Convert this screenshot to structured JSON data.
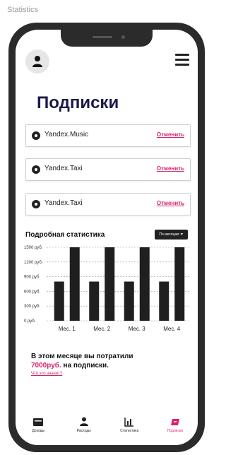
{
  "frame_caption": "Statistics",
  "header": {
    "title": "Подписки"
  },
  "subscriptions": [
    {
      "name": "Yandex.Music",
      "action": "Отменить"
    },
    {
      "name": "Yandex.Taxi",
      "action": "Отменить"
    },
    {
      "name": "Yandex.Taxi",
      "action": "Отменить"
    }
  ],
  "stats": {
    "title": "Подробная статистика",
    "period_select": "По месяцам ▼"
  },
  "chart_data": {
    "type": "bar",
    "categories": [
      "Mес. 1",
      "Mес. 2",
      "Mес. 3",
      "Mес. 4"
    ],
    "y_tick_labels": [
      "1500 руб.",
      "1200 руб.",
      "900 руб.",
      "600 руб.",
      "300 руб.",
      "0 руб."
    ],
    "ylim": [
      0,
      1500
    ],
    "series": [
      {
        "values": [
          800,
          800,
          800,
          800
        ]
      },
      {
        "values": [
          1500,
          1500,
          1500,
          1500
        ]
      }
    ],
    "colors": [
      "#1f1f1f"
    ]
  },
  "summary": {
    "line1": "В этом месяце вы потратили",
    "amount": "7000руб.",
    "line2_rest": " на подписки.",
    "link": "Что это значит?"
  },
  "tabbar": {
    "items": [
      {
        "label": "Доходы",
        "icon": "wallet-icon"
      },
      {
        "label": "Расходы",
        "icon": "person-icon"
      },
      {
        "label": "Статистика",
        "icon": "chart-icon"
      },
      {
        "label": "Подписки",
        "icon": "ticket-icon"
      }
    ],
    "active": 3,
    "accent": "#d8226e"
  }
}
